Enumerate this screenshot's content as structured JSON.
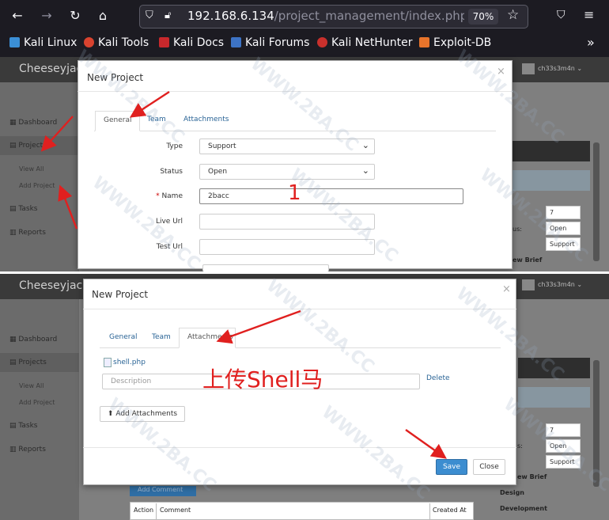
{
  "browser": {
    "url_host": "192.168.6.134",
    "url_path": "/project_management/index.php/pro",
    "zoom": "70%",
    "bookmarks": [
      "Kali Linux",
      "Kali Tools",
      "Kali Docs",
      "Kali Forums",
      "Kali NetHunter",
      "Exploit-DB"
    ]
  },
  "app": {
    "brand": "Cheeseyjack.l",
    "user": "ch33s3m4n",
    "sidebar": [
      "Dashboard",
      "Projects",
      "View All",
      "Add Project",
      "Tasks",
      "Reports"
    ]
  },
  "modal1": {
    "title": "New Project",
    "tabs": [
      "General",
      "Team",
      "Attachments"
    ],
    "type_label": "Type",
    "type_value": "Support",
    "status_label": "Status",
    "status_value": "Open",
    "name_required": "*",
    "name_label": "Name",
    "name_value": "2bacc",
    "live_label": "Live Url",
    "test_label": "Test Url"
  },
  "modal2": {
    "title": "New Project",
    "tabs": [
      "General",
      "Team",
      "Attachments"
    ],
    "file": "shell.php",
    "desc_placeholder": "Description",
    "delete": "Delete",
    "add_attach": "Add Attachments",
    "save": "Save",
    "close": "Close"
  },
  "annotations": {
    "number": "1",
    "upload": "上传Shell马"
  },
  "right_panel": {
    "top": {
      "v1": "7",
      "l2": "us:",
      "v2": "Open",
      "v3": "Support",
      "l4": "ew Brief"
    },
    "bottom": {
      "v1": "7",
      "l2": "s:",
      "v2": "Open",
      "v3": "Support",
      "l4": "ew Brief",
      "l5": "Design",
      "l6": "Development"
    }
  },
  "comments": {
    "add": "Add Comment",
    "cols": [
      "Action",
      "Comment",
      "Created At"
    ]
  },
  "watermark": "WWW.2BA.CC"
}
